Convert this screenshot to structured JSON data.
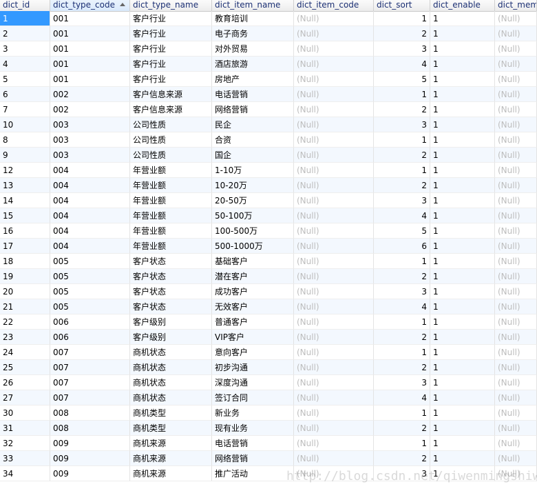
{
  "table": {
    "columns": [
      {
        "label": "dict_id",
        "numeric": false
      },
      {
        "label": "dict_type_code",
        "numeric": false,
        "sorted": true
      },
      {
        "label": "dict_type_name",
        "numeric": false
      },
      {
        "label": "dict_item_name",
        "numeric": false
      },
      {
        "label": "dict_item_code",
        "numeric": false
      },
      {
        "label": "dict_sort",
        "numeric": true
      },
      {
        "label": "dict_enable",
        "numeric": false
      },
      {
        "label": "dict_memo",
        "numeric": false
      }
    ],
    "rows": [
      [
        "1",
        "001",
        "客户行业",
        "教育培训",
        "(Null)",
        "1",
        "1",
        "(Null)"
      ],
      [
        "2",
        "001",
        "客户行业",
        "电子商务",
        "(Null)",
        "2",
        "1",
        "(Null)"
      ],
      [
        "3",
        "001",
        "客户行业",
        "对外贸易",
        "(Null)",
        "3",
        "1",
        "(Null)"
      ],
      [
        "4",
        "001",
        "客户行业",
        "酒店旅游",
        "(Null)",
        "4",
        "1",
        "(Null)"
      ],
      [
        "5",
        "001",
        "客户行业",
        "房地产",
        "(Null)",
        "5",
        "1",
        "(Null)"
      ],
      [
        "6",
        "002",
        "客户信息来源",
        "电话营销",
        "(Null)",
        "1",
        "1",
        "(Null)"
      ],
      [
        "7",
        "002",
        "客户信息来源",
        "网络营销",
        "(Null)",
        "2",
        "1",
        "(Null)"
      ],
      [
        "10",
        "003",
        "公司性质",
        "民企",
        "(Null)",
        "3",
        "1",
        "(Null)"
      ],
      [
        "8",
        "003",
        "公司性质",
        "合资",
        "(Null)",
        "1",
        "1",
        "(Null)"
      ],
      [
        "9",
        "003",
        "公司性质",
        "国企",
        "(Null)",
        "2",
        "1",
        "(Null)"
      ],
      [
        "12",
        "004",
        "年营业额",
        "1-10万",
        "(Null)",
        "1",
        "1",
        "(Null)"
      ],
      [
        "13",
        "004",
        "年营业额",
        "10-20万",
        "(Null)",
        "2",
        "1",
        "(Null)"
      ],
      [
        "14",
        "004",
        "年营业额",
        "20-50万",
        "(Null)",
        "3",
        "1",
        "(Null)"
      ],
      [
        "15",
        "004",
        "年营业额",
        "50-100万",
        "(Null)",
        "4",
        "1",
        "(Null)"
      ],
      [
        "16",
        "004",
        "年营业额",
        "100-500万",
        "(Null)",
        "5",
        "1",
        "(Null)"
      ],
      [
        "17",
        "004",
        "年营业额",
        "500-1000万",
        "(Null)",
        "6",
        "1",
        "(Null)"
      ],
      [
        "18",
        "005",
        "客户状态",
        "基础客户",
        "(Null)",
        "1",
        "1",
        "(Null)"
      ],
      [
        "19",
        "005",
        "客户状态",
        "潜在客户",
        "(Null)",
        "2",
        "1",
        "(Null)"
      ],
      [
        "20",
        "005",
        "客户状态",
        "成功客户",
        "(Null)",
        "3",
        "1",
        "(Null)"
      ],
      [
        "21",
        "005",
        "客户状态",
        "无效客户",
        "(Null)",
        "4",
        "1",
        "(Null)"
      ],
      [
        "22",
        "006",
        "客户级别",
        "普通客户",
        "(Null)",
        "1",
        "1",
        "(Null)"
      ],
      [
        "23",
        "006",
        "客户级别",
        "VIP客户",
        "(Null)",
        "2",
        "1",
        "(Null)"
      ],
      [
        "24",
        "007",
        "商机状态",
        "意向客户",
        "(Null)",
        "1",
        "1",
        "(Null)"
      ],
      [
        "25",
        "007",
        "商机状态",
        "初步沟通",
        "(Null)",
        "2",
        "1",
        "(Null)"
      ],
      [
        "26",
        "007",
        "商机状态",
        "深度沟通",
        "(Null)",
        "3",
        "1",
        "(Null)"
      ],
      [
        "27",
        "007",
        "商机状态",
        "签订合同",
        "(Null)",
        "4",
        "1",
        "(Null)"
      ],
      [
        "30",
        "008",
        "商机类型",
        "新业务",
        "(Null)",
        "1",
        "1",
        "(Null)"
      ],
      [
        "31",
        "008",
        "商机类型",
        "现有业务",
        "(Null)",
        "2",
        "1",
        "(Null)"
      ],
      [
        "32",
        "009",
        "商机来源",
        "电话营销",
        "(Null)",
        "1",
        "1",
        "(Null)"
      ],
      [
        "33",
        "009",
        "商机来源",
        "网络营销",
        "(Null)",
        "2",
        "1",
        "(Null)"
      ],
      [
        "34",
        "009",
        "商机来源",
        "推广活动",
        "(Null)",
        "3",
        "1",
        "(Null)"
      ]
    ]
  },
  "watermark": "http://blog.csdn.net/qiwenmingshiwo",
  "colors": {
    "header_text": "#1b2f73",
    "null_text": "#bdbdbd",
    "selected_bg": "#3399ff",
    "alt_row": "#f3f8fe"
  }
}
